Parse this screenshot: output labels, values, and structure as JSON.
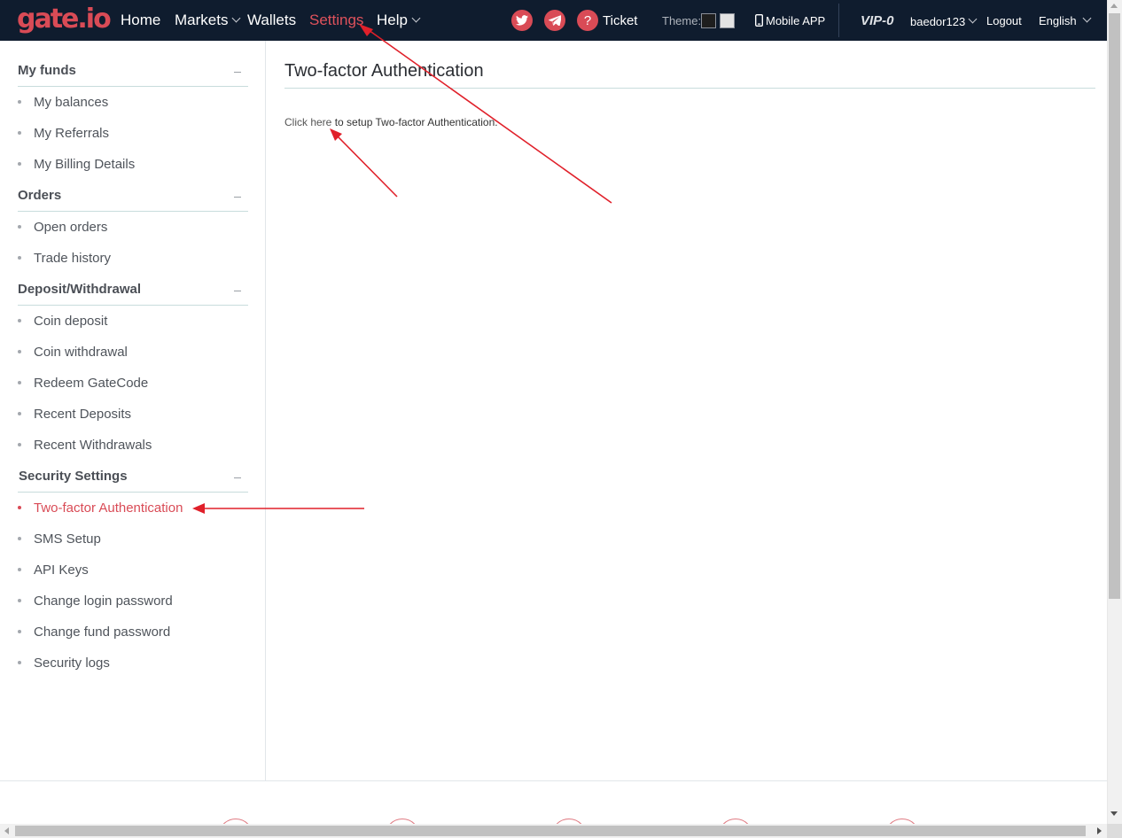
{
  "brand": {
    "logo_text": "gate.io",
    "accent": "#d94b56",
    "nav_bg": "#0f1c2e"
  },
  "nav": {
    "home": "Home",
    "markets": "Markets",
    "wallets": "Wallets",
    "settings": "Settings",
    "help": "Help",
    "ticket": "Ticket",
    "theme_label": "Theme:",
    "mobile_app": "Mobile APP",
    "vip": "VIP-0",
    "username": "baedor123",
    "logout": "Logout",
    "language": "English",
    "icons": [
      "twitter-icon",
      "telegram-icon",
      "question-icon",
      "mobile-phone-icon"
    ],
    "themes": [
      "#1e1e1e",
      "#e3e3e3"
    ]
  },
  "sidebar": {
    "sections": [
      {
        "title": "My funds",
        "items": [
          "My balances",
          "My Referrals",
          "My Billing Details"
        ]
      },
      {
        "title": "Orders",
        "items": [
          "Open orders",
          "Trade history"
        ]
      },
      {
        "title": "Deposit/Withdrawal",
        "items": [
          "Coin deposit",
          "Coin withdrawal",
          "Redeem GateCode",
          "Recent Deposits",
          "Recent Withdrawals"
        ]
      },
      {
        "title": "Security Settings",
        "items": [
          "Two-factor Authentication",
          "SMS Setup",
          "API Keys",
          "Change login password",
          "Change fund password",
          "Security logs"
        ]
      }
    ],
    "toggle_symbol": "–",
    "active_item": "Two-factor Authentication"
  },
  "main": {
    "title": "Two-factor Authentication",
    "link_text": "Click here",
    "rest_text": " to setup Two-factor Authentication."
  },
  "annotations": {
    "arrow_color": "#e0202a"
  }
}
